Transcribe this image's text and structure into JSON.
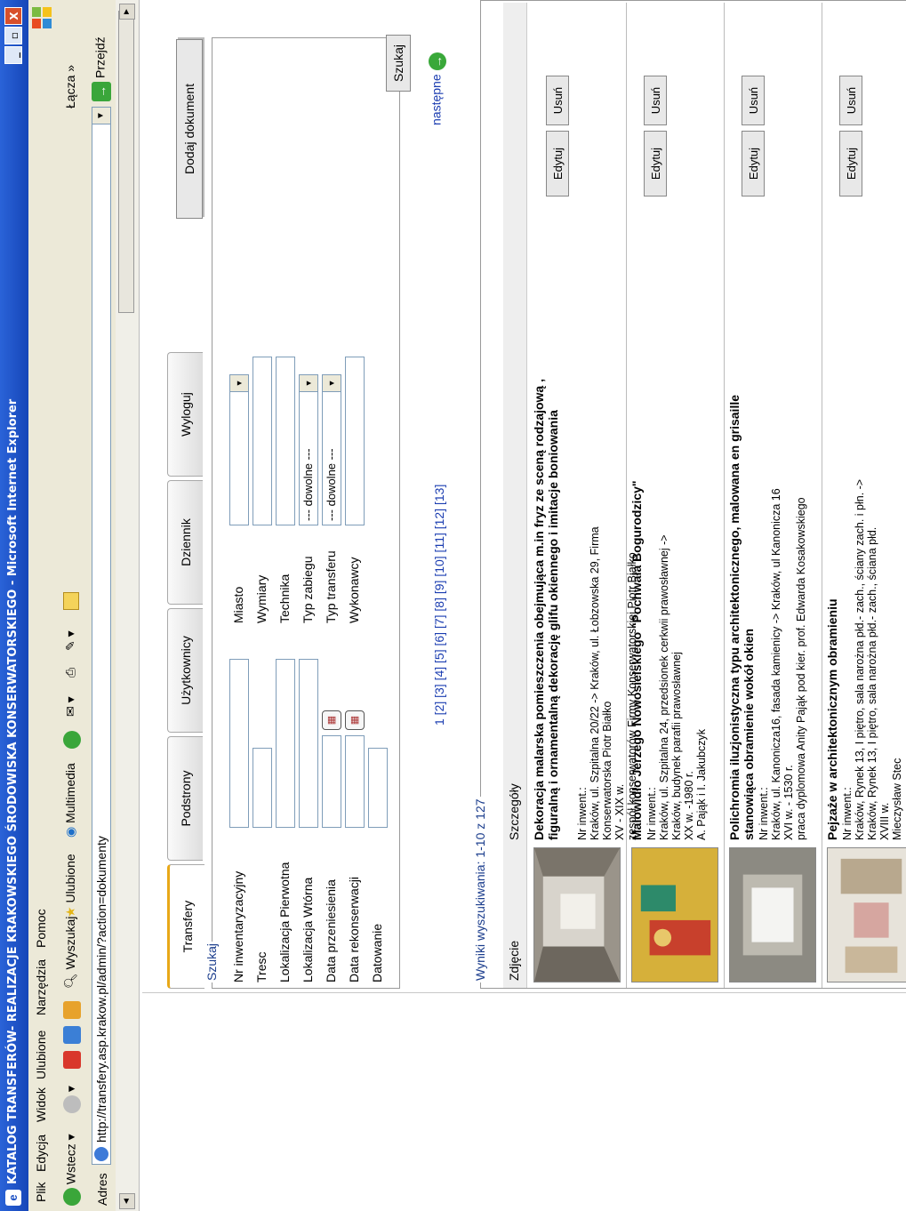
{
  "window": {
    "title": "KATALOG TRANSFERÓW- REALIZACJE KRAKOWSKIEGO ŚRODOWISKA KONSERWATORSKIEGO - Microsoft Internet Explorer",
    "buttons": [
      "_",
      "▫",
      "X"
    ]
  },
  "menu": [
    "Plik",
    "Edycja",
    "Widok",
    "Ulubione",
    "Narzędzia",
    "Pomoc"
  ],
  "toolbar": {
    "back": "Wstecz",
    "search": "Wyszukaj",
    "favorites": "Ulubione",
    "multimedia": "Multimedia",
    "links": "Łącza"
  },
  "address": {
    "label": "Adres",
    "url": "http://transfery.asp.krakow.pl/admin/?action=dokumenty",
    "go": "Przejdź"
  },
  "tabs": [
    "Transfery",
    "Podstrony",
    "Użytkownicy",
    "Dziennik",
    "Wyloguj"
  ],
  "add_document": "Dodaj dokument",
  "search": {
    "legend": "Szukaj",
    "left_labels": [
      "Nr inwentaryzacyjny",
      "Tresc",
      "Lokalizacja Pierwotna",
      "Lokalizacja Wtórna",
      "Data przeniesienia",
      "Data rekonserwacji",
      "Datowanie"
    ],
    "right_labels": [
      "Miasto",
      "Wymiary",
      "Technika",
      "Typ zabiegu",
      "Typ transferu",
      "Wykonawcy"
    ],
    "select_default": "--- dowolne ---",
    "button": "Szukaj"
  },
  "pager": {
    "pages": "1 [2] [3] [4] [5] [6] [7] [8] [9] [10] [11] [12] [13]",
    "next": "następne"
  },
  "results": {
    "legend": "Wyniki wyszukiwania: 1-10 z 127",
    "col_photo": "Zdjęcie",
    "col_details": "Szczegóły",
    "edit": "Edytuj",
    "delete": "Usuń",
    "items": [
      {
        "title": "Dekoracja malarska pomieszczenia obejmująca m.in fryz ze sceną rodzajową , figuralną i ornamentalną dekorację glifu okiennego i imitacje boniowania",
        "lines": [
          "Nr inwent.:",
          "Kraków, ul. Szpitalna 20/22 -> Kraków, ul. Łobzowska 29, Firma Konserwatorska Piotr Białko",
          "XV - XIX w.",
          "zespół konserwatorów Firmy Konserwatorskiej Piotr Białko"
        ]
      },
      {
        "title": "Malowidło Jerzego Nowosielskiego \"Pochwała Bogurodzicy\"",
        "lines": [
          "Nr inwent.:",
          "Kraków, ul. Szpitalna 24, przedsionek cerkwii prawosławnej -> Kraków, budynek parafii prawosławnej",
          "XX w. -1980 r.",
          "A. Pająk i I. Jakubczyk"
        ]
      },
      {
        "title": "Polichromia iluzjonistyczna typu architektonicznego, malowana en grisaille stanowiąca obramienie wokół okien",
        "lines": [
          "Nr inwent.:",
          "Kraków, ul. Kanonicza16, fasada kamienicy -> Kraków, ul Kanonicza 16",
          "XVI w. - 1530 r.",
          "praca dyplomowa Anity Pająk pod kier. prof. Edwarda Kosakowskiego"
        ]
      },
      {
        "title": "Pejzaże w architektonicznym obramieniu",
        "lines": [
          "Nr inwent.:",
          "Kraków, Rynek 13, I piętro, sala narożna płd.- zach., ściany zach. i płn. ->",
          "Kraków, Rynek 13, I piętro, sala narożna płd.- zach., ściana płd.",
          "XVIII w.",
          "Mieczysław Stec"
        ]
      }
    ]
  }
}
